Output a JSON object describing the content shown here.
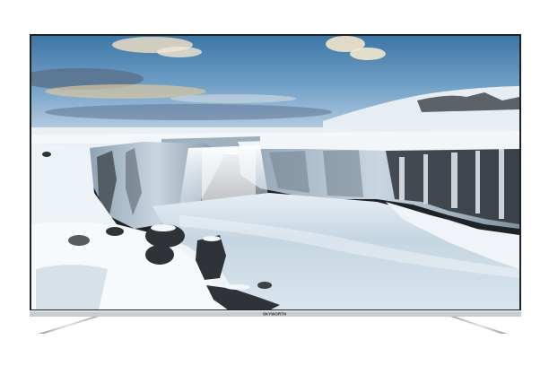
{
  "product": {
    "brand_mark": "SKYWORTH",
    "screen_subject": "frozen-waterfall-landscape"
  },
  "colors": {
    "background": "#ffffff",
    "bezel": "#1f2226",
    "sky_top": "#3f78a6",
    "sky_mid": "#7aa4c9",
    "sky_haze": "#b9cfe2",
    "snow": "#eef3f7",
    "ice_shadow": "#b8c7d4",
    "water": "#c7d7e3",
    "rock": "#2f3236",
    "stand": "#b5b8bc",
    "bottom_bar": "#c9ccd0"
  },
  "icons": {
    "stand_left": "tv-stand-left-icon",
    "stand_right": "tv-stand-right-icon"
  }
}
